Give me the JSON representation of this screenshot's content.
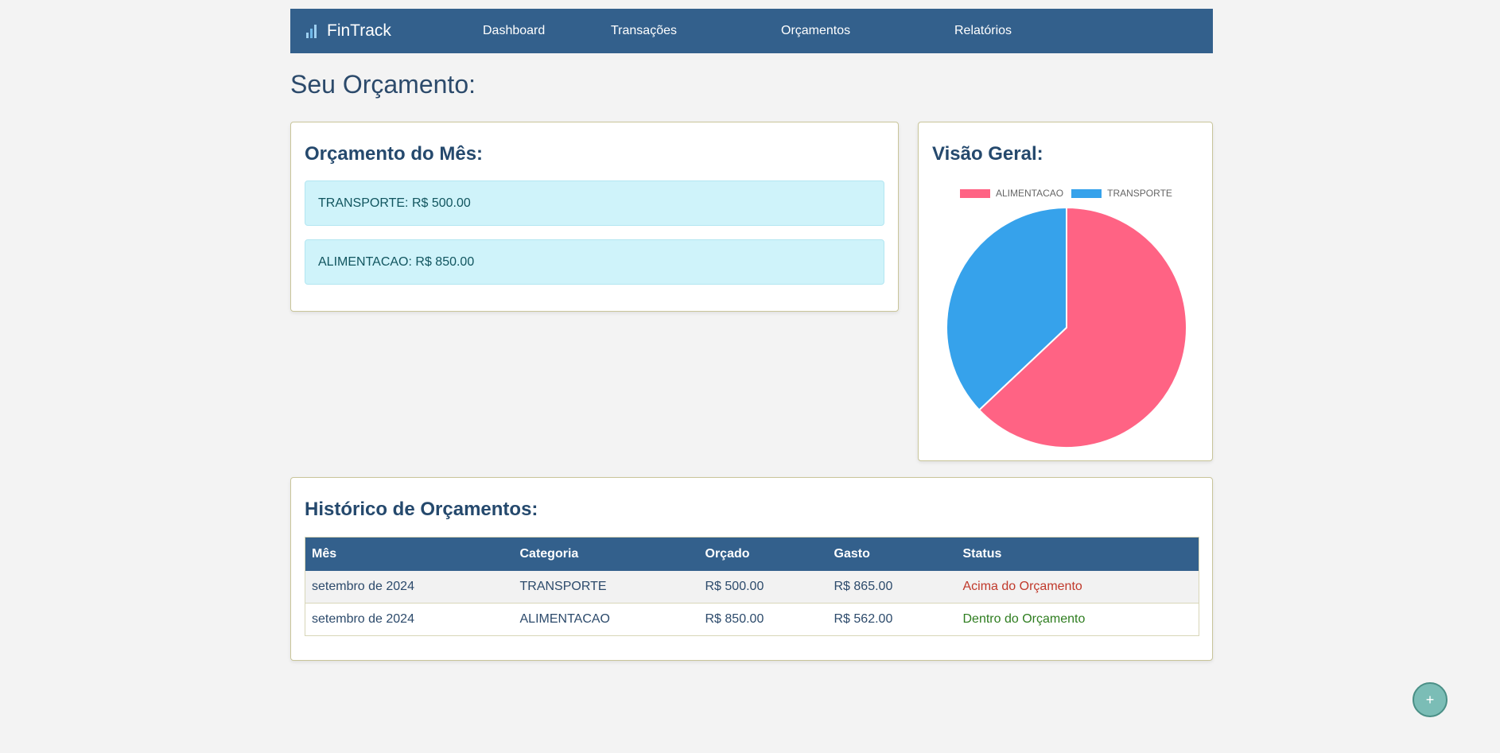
{
  "navbar": {
    "brand": "FinTrack",
    "links": [
      "Dashboard",
      "Transações",
      "Orçamentos",
      "Relatórios"
    ]
  },
  "page_title": "Seu Orçamento:",
  "budget": {
    "title": "Orçamento do Mês:",
    "items": [
      "TRANSPORTE: R$ 500.00",
      "ALIMENTACAO: R$ 850.00"
    ]
  },
  "overview": {
    "title": "Visão Geral:",
    "legend": [
      {
        "label": "ALIMENTACAO",
        "color": "#ff6384"
      },
      {
        "label": "TRANSPORTE",
        "color": "#36a2eb"
      }
    ]
  },
  "chart_data": {
    "type": "pie",
    "categories": [
      "ALIMENTACAO",
      "TRANSPORTE"
    ],
    "values": [
      850,
      500
    ],
    "colors": [
      "#ff6384",
      "#36a2eb"
    ],
    "legend_position": "top"
  },
  "history": {
    "title": "Histórico de Orçamentos:",
    "columns": [
      "Mês",
      "Categoria",
      "Orçado",
      "Gasto",
      "Status"
    ],
    "rows": [
      {
        "mes": "setembro de 2024",
        "categoria": "TRANSPORTE",
        "orcado": "R$ 500.00",
        "gasto": "R$ 865.00",
        "status": "Acima do Orçamento"
      },
      {
        "mes": "setembro de 2024",
        "categoria": "ALIMENTACAO",
        "orcado": "R$ 850.00",
        "gasto": "R$ 562.00",
        "status": "Dentro do Orçamento"
      }
    ]
  },
  "fab": {
    "label": "+"
  },
  "colors": {
    "navbar": "#33608c",
    "over": "#c0392b",
    "ok": "#2e7d1f"
  }
}
